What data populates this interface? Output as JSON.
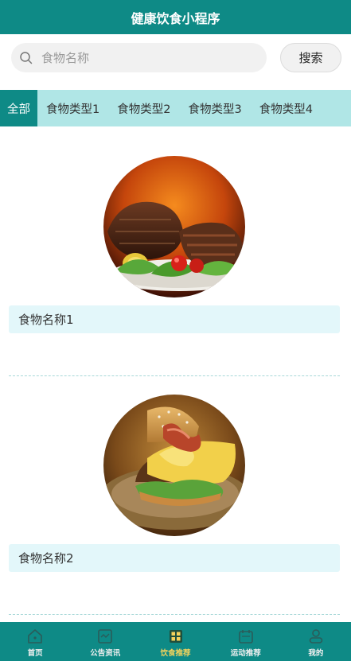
{
  "header": {
    "title": "健康饮食小程序"
  },
  "search": {
    "placeholder": "食物名称",
    "button_label": "搜索"
  },
  "tabs": [
    {
      "label": "全部",
      "active": true
    },
    {
      "label": "食物类型1",
      "active": false
    },
    {
      "label": "食物类型2",
      "active": false
    },
    {
      "label": "食物类型3",
      "active": false
    },
    {
      "label": "食物类型4",
      "active": false
    }
  ],
  "foods": [
    {
      "name": "食物名称1",
      "image": "grilled-steak-salad"
    },
    {
      "name": "食物名称2",
      "image": "bacon-cheeseburger"
    }
  ],
  "tabbar": {
    "items": [
      {
        "label": "首页",
        "icon": "home-icon",
        "active": false
      },
      {
        "label": "公告资讯",
        "icon": "news-icon",
        "active": false
      },
      {
        "label": "饮食推荐",
        "icon": "grid-icon",
        "active": true
      },
      {
        "label": "运动推荐",
        "icon": "calendar-icon",
        "active": false
      },
      {
        "label": "我的",
        "icon": "user-icon",
        "active": false
      }
    ]
  },
  "colors": {
    "primary": "#0e8a86",
    "tab_bg": "#b0e6e6",
    "name_bar_bg": "#e3f7fa",
    "tabbar_active": "#f6d35c"
  }
}
